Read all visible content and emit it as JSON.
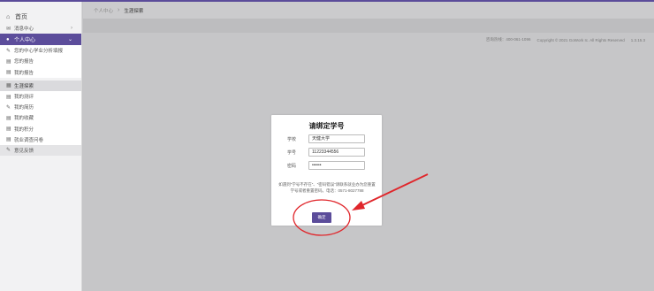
{
  "sidebar": {
    "home_label": "首页",
    "items": [
      {
        "icon": "chat-icon",
        "label": "消息中心",
        "chevron": "›"
      },
      {
        "icon": "user-icon",
        "label": "个人中心",
        "chevron": "⌄"
      },
      {
        "icon": "edit-icon",
        "label": "您的中心学业分析填报"
      },
      {
        "icon": "doc-icon",
        "label": "您的报告"
      },
      {
        "icon": "doc-icon",
        "label": "我的报告"
      },
      {
        "icon": "calendar-icon",
        "label": "生涯探索"
      },
      {
        "icon": "doc-icon",
        "label": "我的测评"
      },
      {
        "icon": "edit-icon",
        "label": "我的简历"
      },
      {
        "icon": "doc-icon",
        "label": "我的收藏"
      },
      {
        "icon": "doc-icon",
        "label": "我的积分"
      },
      {
        "icon": "doc-icon",
        "label": "就业调查问卷"
      },
      {
        "icon": "edit-icon",
        "label": "意见反馈"
      }
    ]
  },
  "breadcrumb": {
    "parent": "个人中心",
    "separator": "›",
    "current": "生涯探索"
  },
  "footer": {
    "hotline": "咨询热线：400-061-1096",
    "copyright": "Copyright © 2021 GoWork Ic. All Rights Reserved",
    "version": "1.3.15.3"
  },
  "modal": {
    "title": "请绑定学号",
    "school_label": "学校",
    "school_value": "天健大学",
    "id_label": "学号",
    "id_value": "11223344556",
    "password_label": "密码",
    "password_value": "••••••",
    "hint": "如遇到“学号不存在”、“密码错误”请联系就业办为您重置学号或者重置密码。电话：0571-8027788",
    "confirm_label": "确定"
  },
  "colors": {
    "accent": "#5b4c9a",
    "annotation": "#e0262b"
  }
}
